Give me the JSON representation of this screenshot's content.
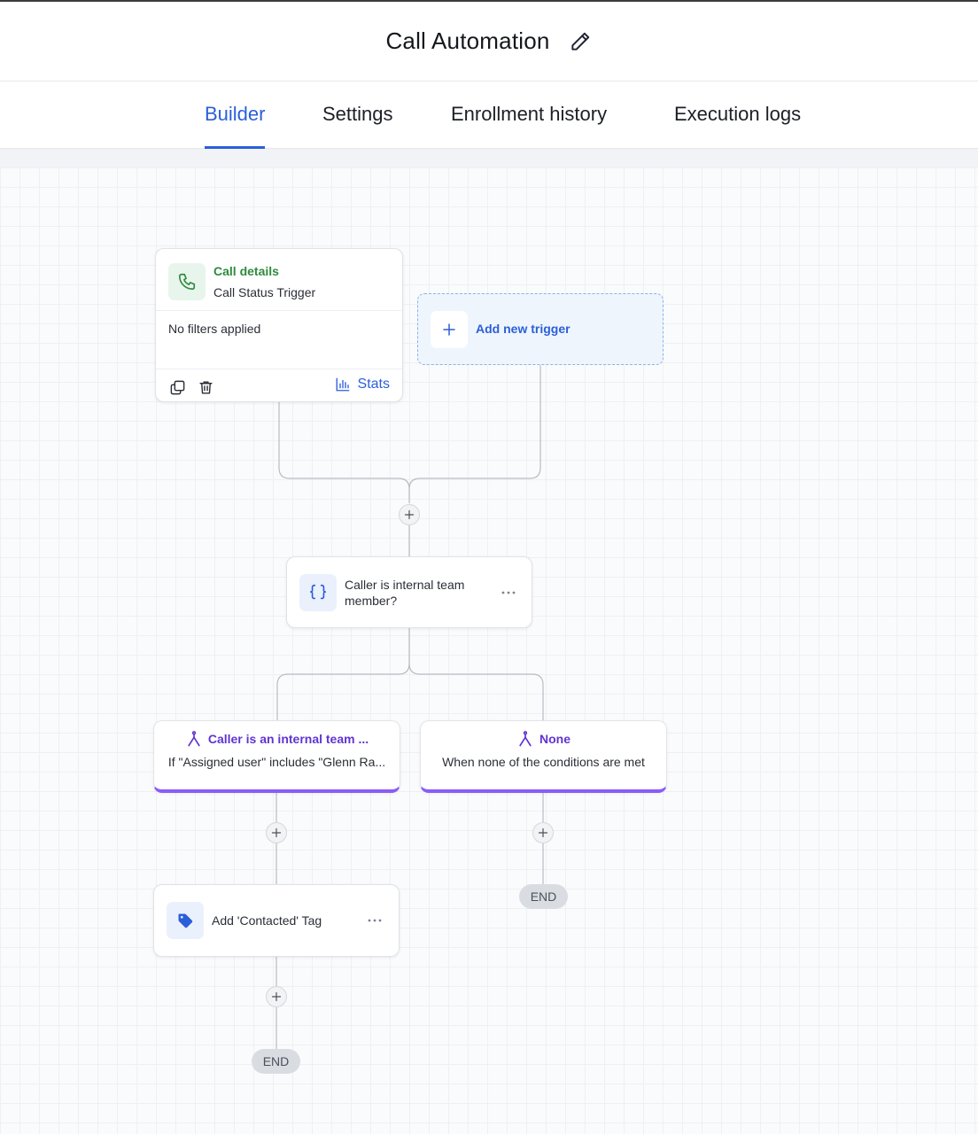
{
  "header": {
    "title": "Call Automation",
    "edit_icon": "pencil-icon"
  },
  "tabs": [
    {
      "label": "Builder",
      "active": true
    },
    {
      "label": "Settings",
      "active": false
    },
    {
      "label": "Enrollment history",
      "active": false
    },
    {
      "label": "Execution logs",
      "active": false
    }
  ],
  "trigger": {
    "category": "Call details",
    "name": "Call Status Trigger",
    "filters": "No filters applied",
    "stats_label": "Stats",
    "icon": "phone-icon"
  },
  "add_trigger": {
    "label": "Add new trigger"
  },
  "condition": {
    "label": "Caller is internal team member?",
    "icon": "curly-braces-icon"
  },
  "branches": [
    {
      "title": "Caller is an internal team ...",
      "description": "If \"Assigned user\" includes \"Glenn Ra..."
    },
    {
      "title": "None",
      "description": "When none of the conditions are met"
    }
  ],
  "action": {
    "label": "Add 'Contacted' Tag",
    "icon": "tag-icon"
  },
  "end_label": "END",
  "colors": {
    "accent": "#2b5fd9",
    "trigger_green": "#2e8b3e",
    "branch_purple": "#8b5cf6",
    "branch_title": "#6234d1"
  }
}
